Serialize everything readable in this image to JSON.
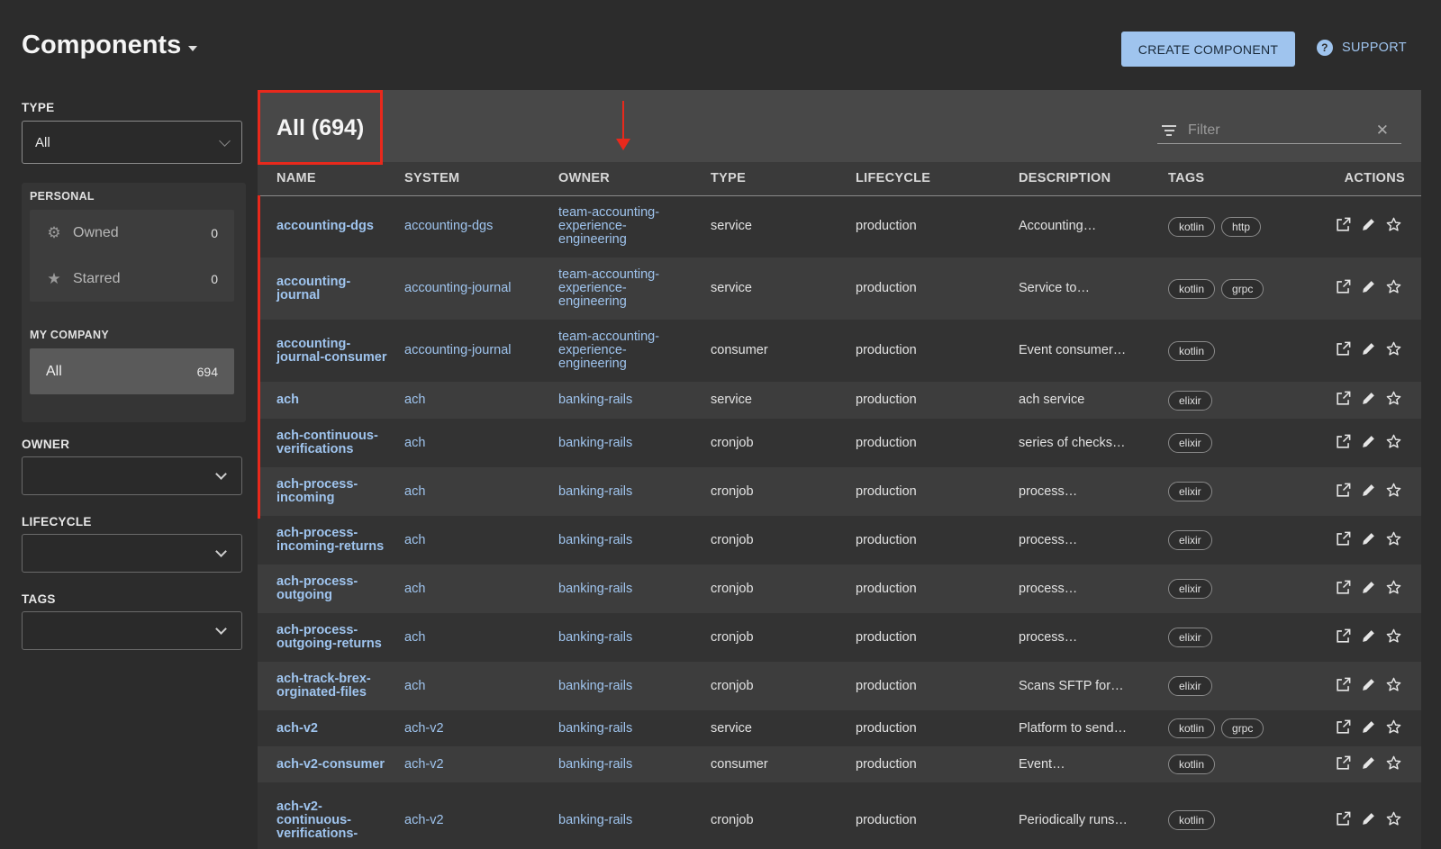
{
  "header": {
    "title": "Components",
    "create_label": "CREATE COMPONENT",
    "support_label": "SUPPORT"
  },
  "sidebar": {
    "type_label": "TYPE",
    "type_value": "All",
    "personal_label": "PERSONAL",
    "personal_items": [
      {
        "label": "Owned",
        "count": "0",
        "icon": "gear-icon"
      },
      {
        "label": "Starred",
        "count": "0",
        "icon": "star-icon"
      }
    ],
    "company_label": "MY COMPANY",
    "company_items": [
      {
        "label": "All",
        "count": "694"
      }
    ],
    "owner_label": "OWNER",
    "lifecycle_label": "LIFECYCLE",
    "tags_label": "TAGS"
  },
  "main": {
    "title": "All (694)",
    "filter_placeholder": "Filter",
    "columns": [
      "NAME",
      "SYSTEM",
      "OWNER",
      "TYPE",
      "LIFECYCLE",
      "DESCRIPTION",
      "TAGS",
      "ACTIONS"
    ],
    "rows": [
      {
        "name": [
          "accounting-dgs"
        ],
        "system": "accounting-dgs",
        "owner": [
          "team-accounting-",
          "experience-",
          "engineering"
        ],
        "type": "service",
        "lifecycle": "production",
        "description": "Accounting…",
        "tags": [
          "kotlin",
          "http"
        ]
      },
      {
        "name": [
          "accounting-",
          "journal"
        ],
        "system": "accounting-journal",
        "owner": [
          "team-accounting-",
          "experience-",
          "engineering"
        ],
        "type": "service",
        "lifecycle": "production",
        "description": "Service to…",
        "tags": [
          "kotlin",
          "grpc"
        ]
      },
      {
        "name": [
          "accounting-",
          "journal-consumer"
        ],
        "system": "accounting-journal",
        "owner": [
          "team-accounting-",
          "experience-",
          "engineering"
        ],
        "type": "consumer",
        "lifecycle": "production",
        "description": "Event consumer…",
        "tags": [
          "kotlin"
        ]
      },
      {
        "name": [
          "ach"
        ],
        "system": "ach",
        "owner": [
          "banking-rails"
        ],
        "type": "service",
        "lifecycle": "production",
        "description": "ach service",
        "tags": [
          "elixir"
        ]
      },
      {
        "name": [
          "ach-continuous-",
          "verifications"
        ],
        "system": "ach",
        "owner": [
          "banking-rails"
        ],
        "type": "cronjob",
        "lifecycle": "production",
        "description": "series of checks…",
        "tags": [
          "elixir"
        ]
      },
      {
        "name": [
          "ach-process-",
          "incoming"
        ],
        "system": "ach",
        "owner": [
          "banking-rails"
        ],
        "type": "cronjob",
        "lifecycle": "production",
        "description": "process…",
        "tags": [
          "elixir"
        ]
      },
      {
        "name": [
          "ach-process-",
          "incoming-returns"
        ],
        "system": "ach",
        "owner": [
          "banking-rails"
        ],
        "type": "cronjob",
        "lifecycle": "production",
        "description": "process…",
        "tags": [
          "elixir"
        ]
      },
      {
        "name": [
          "ach-process-",
          "outgoing"
        ],
        "system": "ach",
        "owner": [
          "banking-rails"
        ],
        "type": "cronjob",
        "lifecycle": "production",
        "description": "process…",
        "tags": [
          "elixir"
        ]
      },
      {
        "name": [
          "ach-process-",
          "outgoing-returns"
        ],
        "system": "ach",
        "owner": [
          "banking-rails"
        ],
        "type": "cronjob",
        "lifecycle": "production",
        "description": "process…",
        "tags": [
          "elixir"
        ]
      },
      {
        "name": [
          "ach-track-brex-",
          "orginated-files"
        ],
        "system": "ach",
        "owner": [
          "banking-rails"
        ],
        "type": "cronjob",
        "lifecycle": "production",
        "description": "Scans SFTP for…",
        "tags": [
          "elixir"
        ]
      },
      {
        "name": [
          "ach-v2"
        ],
        "system": "ach-v2",
        "owner": [
          "banking-rails"
        ],
        "type": "service",
        "lifecycle": "production",
        "description": "Platform to send…",
        "tags": [
          "kotlin",
          "grpc"
        ]
      },
      {
        "name": [
          "ach-v2-consumer"
        ],
        "system": "ach-v2",
        "owner": [
          "banking-rails"
        ],
        "type": "consumer",
        "lifecycle": "production",
        "description": "Event…",
        "tags": [
          "kotlin"
        ]
      },
      {
        "name": [
          "ach-v2-",
          "continuous-",
          "verifications-"
        ],
        "system": "ach-v2",
        "owner": [
          "banking-rails"
        ],
        "type": "cronjob",
        "lifecycle": "production",
        "description": "Periodically runs…",
        "tags": [
          "kotlin"
        ]
      }
    ]
  },
  "colors": {
    "accent": "#9fc4ee",
    "highlight": "#e8291c",
    "background": "#2c2c2c"
  }
}
